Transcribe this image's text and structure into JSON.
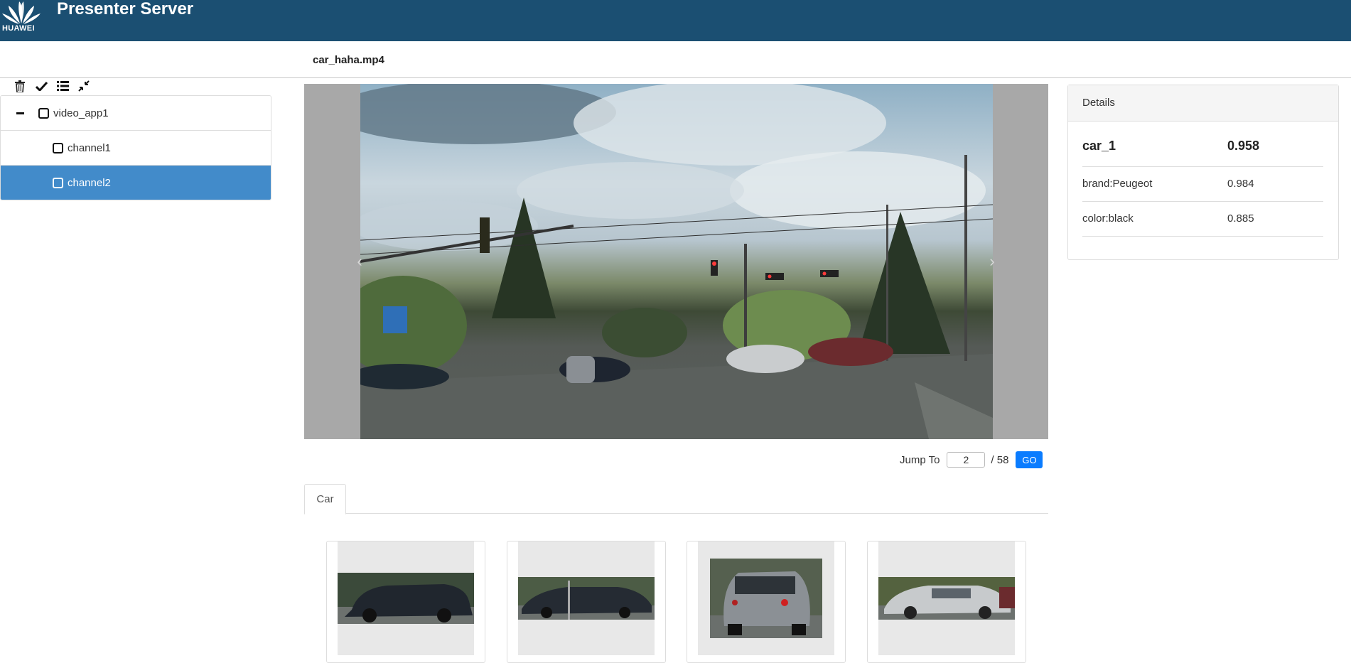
{
  "header": {
    "logo_text": "HUAWEI",
    "title": "Presenter Server"
  },
  "file": {
    "name": "car_haha.mp4"
  },
  "toolbar": {
    "icons": [
      "trash-icon",
      "check-icon",
      "list-icon",
      "compress-icon"
    ]
  },
  "tree": {
    "items": [
      {
        "label": "video_app1",
        "level": 0,
        "selected": false
      },
      {
        "label": "channel1",
        "level": 1,
        "selected": false
      },
      {
        "label": "channel2",
        "level": 1,
        "selected": true
      }
    ]
  },
  "pager": {
    "jump_label": "Jump To",
    "current_page": "2",
    "total": "/ 58",
    "go_label": "GO"
  },
  "tabs": [
    {
      "label": "Car",
      "active": true
    }
  ],
  "details": {
    "heading": "Details",
    "rows": [
      {
        "key": "car_1",
        "value": "0.958"
      },
      {
        "key": "brand:Peugeot",
        "value": "0.984"
      },
      {
        "key": "color:black",
        "value": "0.885"
      }
    ]
  },
  "colors": {
    "header_bg": "#1b4f72",
    "selected_bg": "#428bca",
    "go_button": "#0a7cff"
  }
}
